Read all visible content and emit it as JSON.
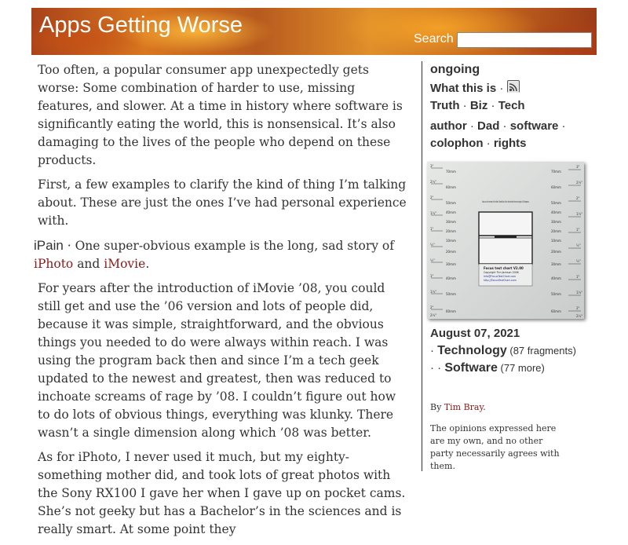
{
  "header": {
    "site_title": "Apps Getting Worse",
    "search_label": "Search",
    "search_placeholder": ""
  },
  "article": {
    "para1": "Too often, a popular consumer app unexpectedly gets worse: Some combination of harder to use, missing features, and slower. At a time in history where software is significantly eating the world, this is nonsensical. It’s also damaging to the lives of the people who depend on these products.",
    "para2": "First, a few examples to clarify the kind of thing I’m talking about. These are just the ones I’ve had personal experience with.",
    "section_heading": "iPain",
    "para3_sep": " · ",
    "para3_text": "One super-obvious example is the long, sad story of ",
    "para3_link1": "iPhoto",
    "para3_and": " and ",
    "para3_link2": "iMovie",
    "para3_end": ".",
    "para4": "For years after the introduction of iMovie ’08, you could still get and use the ’06 version and lots of people did, because it was simple, straightforward, and the obvious things you needed to do were always within reach. I was using the program back then and since I’m a tech geek updated to the newest and greatest, then was reduced to inchoate screams of rage by ’08. I couldn’t figure out how to do lots of obvious things, everything was klunky. There wasn’t a single dimension along which ’08 was better.",
    "para5": "As for iPhoto, I never used it much, but my eighty-something mother did, and took lots of great photos with the Sony RX100 I gave her when I gave up on pocket cams. She’s not geeky but has a Bachelor’s in the sciences and is really smart. At some point they"
  },
  "sidebar": {
    "title": "ongoing",
    "what_this_is": "What this is",
    "sep": " · ",
    "truth": "Truth",
    "biz": "Biz",
    "tech": "Tech",
    "author": "author",
    "dad": "Dad",
    "software": "software",
    "colophon": "colophon",
    "rights": "rights",
    "photo": {
      "top_text": "Focus on the center of the third. Read this of the line behind from an angle of 45 degrees.",
      "bottom_title": "Focus test chart V2.00",
      "bottom_copy": "Copyright Tim Jackson 2006",
      "bottom_link1": "Info@FocusTestChart.com",
      "bottom_link2": "http://FocusTestChart.com",
      "left_ticks": [
        "3\"",
        "2½\"",
        "2\"",
        "1½\"",
        "1\"",
        "½\"",
        "½\"",
        "1\"",
        "1½\"",
        "2\"",
        "2½\""
      ],
      "left_mm": [
        "70mm",
        "60mm",
        "50mm",
        "40mm",
        "30mm",
        "20mm",
        "10mm",
        "20mm",
        "30mm",
        "40mm",
        "50mm",
        "60mm"
      ],
      "right_mm": [
        "70mm",
        "60mm",
        "50mm",
        "40mm",
        "30mm",
        "20mm",
        "10mm",
        "20mm",
        "30mm",
        "40mm",
        "50mm",
        "60mm"
      ],
      "right_ticks": [
        "3\"",
        "2½\"",
        "2\"",
        "1½\"",
        "1\"",
        "½\"",
        "½\"",
        "1\"",
        "1½\"",
        "2\"",
        "2½\""
      ]
    },
    "date_month_day": "August 07",
    "date_comma": ",",
    "date_year": "2021",
    "cat1_prefix": "· ",
    "cat1_name": "Technology",
    "cat1_count": " (87 fragments)",
    "cat2_prefix": "· · ",
    "cat2_name": "Software",
    "cat2_count": " (77 more)",
    "byline_by": "By ",
    "byline_author": "Tim Bray",
    "byline_end": ".",
    "disclaimer": "The opinions expressed here are my own, and no other party necessarily agrees with them."
  }
}
